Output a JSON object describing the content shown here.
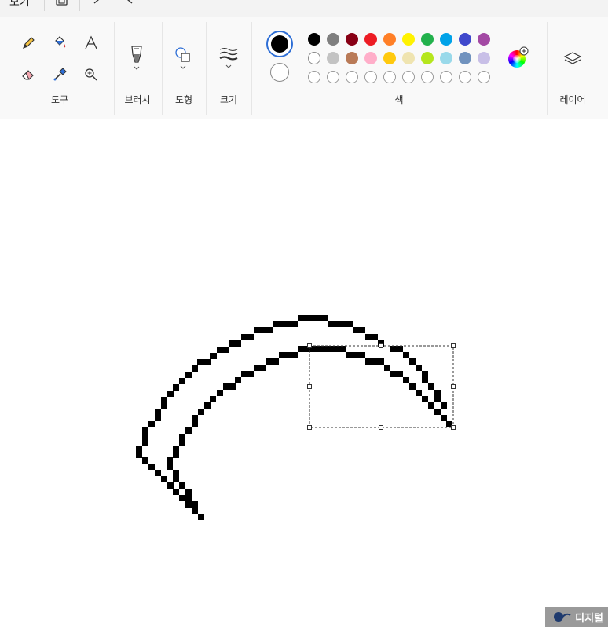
{
  "menu": {
    "view_label": "보기"
  },
  "ribbon": {
    "tools_label": "도구",
    "brushes_label": "브러시",
    "shapes_label": "도형",
    "size_label": "크기",
    "colors_label": "색",
    "layers_label": "레이어"
  },
  "colors": {
    "primary": "#000000",
    "secondary": "#ffffff",
    "row1": [
      "#000000",
      "#7f7f7f",
      "#880015",
      "#ed1c24",
      "#ff7f27",
      "#fff200",
      "#22b14c",
      "#00a2e8",
      "#3f48cc",
      "#a349a4"
    ],
    "row2": [
      "#ffffff",
      "#c3c3c3",
      "#b97a57",
      "#ffaec9",
      "#ffc90e",
      "#efe4b0",
      "#b5e61d",
      "#99d9ea",
      "#7092be",
      "#c8bfe7"
    ],
    "row3_empty_count": 10
  },
  "watermark": {
    "text": "디지털"
  }
}
